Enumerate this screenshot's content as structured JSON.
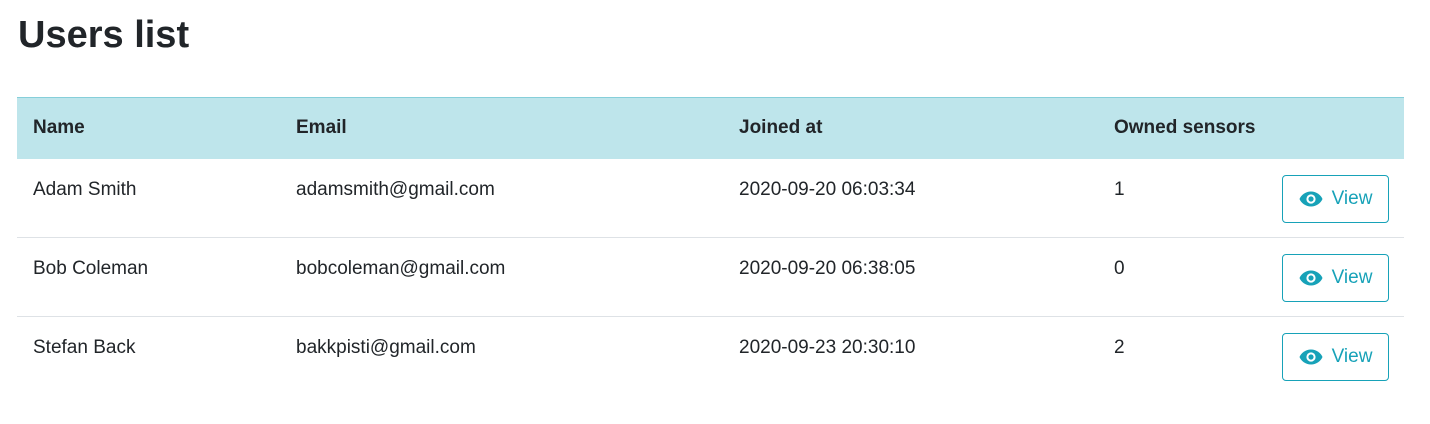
{
  "page": {
    "title": "Users list"
  },
  "table": {
    "headers": {
      "name": "Name",
      "email": "Email",
      "joined": "Joined at",
      "sensors": "Owned sensors"
    },
    "rows": [
      {
        "name": "Adam Smith",
        "email": "adamsmith@gmail.com",
        "joined": "2020-09-20 06:03:34",
        "sensors": "1",
        "action": "View"
      },
      {
        "name": "Bob Coleman",
        "email": "bobcoleman@gmail.com",
        "joined": "2020-09-20 06:38:05",
        "sensors": "0",
        "action": "View"
      },
      {
        "name": "Stefan Back",
        "email": "bakkpisti@gmail.com",
        "joined": "2020-09-23 20:30:10",
        "sensors": "2",
        "action": "View"
      }
    ]
  },
  "icons": {
    "view": "eye-icon"
  },
  "colors": {
    "header_background": "#bee5eb",
    "accent": "#17a2b8",
    "text": "#212529"
  }
}
